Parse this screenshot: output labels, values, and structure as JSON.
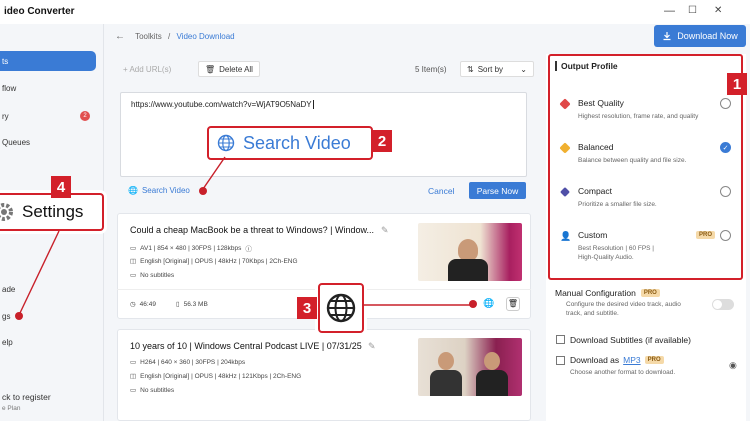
{
  "app": {
    "title": "ideo Converter"
  },
  "window": {
    "minimize": "—",
    "maximize": "☐",
    "close": "✕"
  },
  "sidebar": {
    "items": [
      {
        "label": "ts",
        "active": true
      },
      {
        "label": "flow"
      },
      {
        "label": "ry",
        "badge": "2"
      },
      {
        "label": "Queues"
      },
      {
        "label": "ade"
      },
      {
        "label": "gs"
      },
      {
        "label": "elp"
      }
    ],
    "register": "ck to register",
    "plan": "e Plan"
  },
  "breadcrumb": {
    "root": "Toolkits",
    "sep": "/",
    "current": "Video Download"
  },
  "header": {
    "download_now": "Download Now"
  },
  "toolbar": {
    "add_url": "+ Add URL(s)",
    "delete_all": "Delete All",
    "item_count": "5 Item(s)",
    "sort_by": "Sort by"
  },
  "url_input": {
    "value": "https://www.youtube.com/watch?v=WjAT9O5NaDY"
  },
  "search": {
    "link": "Search Video",
    "callout": "Search Video",
    "cancel": "Cancel",
    "parse_now": "Parse Now"
  },
  "settings_callout": {
    "label": "Settings"
  },
  "videos": [
    {
      "title": "Could a cheap MacBook be a threat to Windows? | Window...",
      "video": "AV1 | 854 × 480 | 30FPS | 128kbps",
      "audio": "English [Original] | OPUS | 48kHz | 70Kbps | 2Ch-ENG",
      "subs": "No subtitles",
      "duration": "46:49",
      "size": "56.3 MB"
    },
    {
      "title": "10 years of 10 | Windows Central Podcast LIVE | 07/31/25",
      "video": "H264 | 640 × 360 | 30FPS | 204kbps",
      "audio": "English [Original] | OPUS | 48kHz | 121Kbps | 2Ch-ENG",
      "subs": "No subtitles"
    }
  ],
  "output_profile": {
    "title": "Output Profile",
    "profiles": [
      {
        "name": "Best Quality",
        "desc": "Highest resolution, frame rate, and quality",
        "color": "#e04848",
        "selected": false
      },
      {
        "name": "Balanced",
        "desc": "Balance between quality and file size.",
        "color": "#f0b030",
        "selected": true
      },
      {
        "name": "Compact",
        "desc": "Prioritize a smaller file size.",
        "color": "#5050a8",
        "selected": false
      },
      {
        "name": "Custom",
        "desc": "Best Resolution | 60 FPS |",
        "desc2": "High-Quality Audio.",
        "color": "#3a7bd5",
        "selected": false,
        "pro": "PRO"
      }
    ]
  },
  "options": {
    "manual_config": "Manual Configuration",
    "manual_pro": "PRO",
    "manual_desc": "Configure the desired video track, audio track, and subtitle.",
    "download_subs": "Download Subtitles (if available)",
    "download_as": "Download as",
    "mp3": "MP3",
    "mp3_pro": "PRO",
    "mp3_desc": "Choose another format to download."
  },
  "annotations": [
    "1",
    "2",
    "3",
    "4"
  ],
  "colors": {
    "accent": "#3a7bd5",
    "annotation_red": "#d3202a",
    "pro_badge": "#f5d9a8"
  }
}
